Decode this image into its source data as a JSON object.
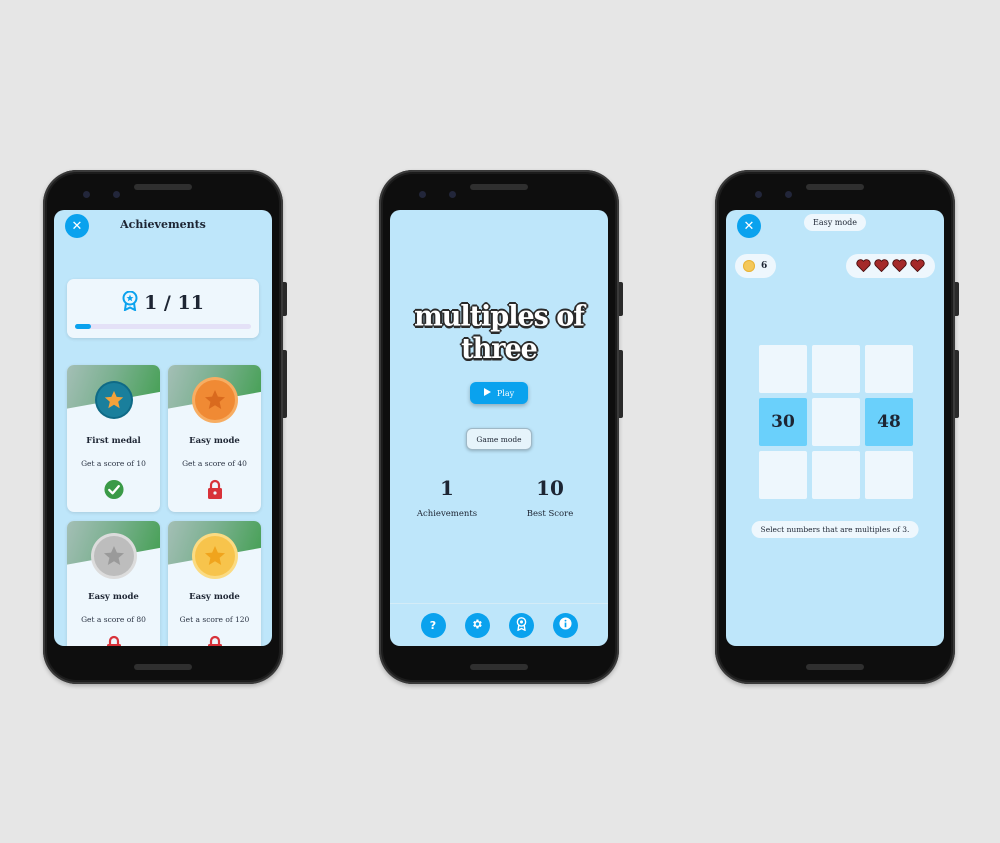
{
  "achievements_screen": {
    "title": "Achievements",
    "progress_text": "1 / 11",
    "progress_fraction": 0.0909,
    "cards": [
      {
        "name": "First medal",
        "desc": "Get a score of 10",
        "medal": "teal-star-medal",
        "status": "unlocked"
      },
      {
        "name": "Easy mode",
        "desc": "Get a score of 40",
        "medal": "bronze-star-medal",
        "status": "locked"
      },
      {
        "name": "Easy mode",
        "desc": "Get a score of 80",
        "medal": "silver-star-medal",
        "status": "locked"
      },
      {
        "name": "Easy mode",
        "desc": "Get a score of 120",
        "medal": "gold-star-medal",
        "status": "locked"
      }
    ]
  },
  "home_screen": {
    "game_title": "multiples of three",
    "play_label": "Play",
    "game_mode_label": "Game mode",
    "achievements_value": "1",
    "achievements_label": "Achievements",
    "best_score_value": "10",
    "best_score_label": "Best Score",
    "nav": [
      "help-icon",
      "settings-icon",
      "achievements-icon",
      "info-icon"
    ]
  },
  "game_screen": {
    "mode_badge": "Easy mode",
    "coins": "6",
    "hearts": 4,
    "grid": [
      "",
      "",
      "",
      "30",
      "",
      "48",
      "",
      "",
      ""
    ],
    "hint": "Select numbers that are multiples of 3."
  },
  "colors": {
    "background": "#e6e6e6",
    "screen": "#bee6fa",
    "accent": "#0aa2ee",
    "card": "#eef7fd",
    "selected_cell": "#6ad0fb",
    "heart": "#a42a2a",
    "lock": "#d8323a",
    "check": "#3a9a47"
  }
}
